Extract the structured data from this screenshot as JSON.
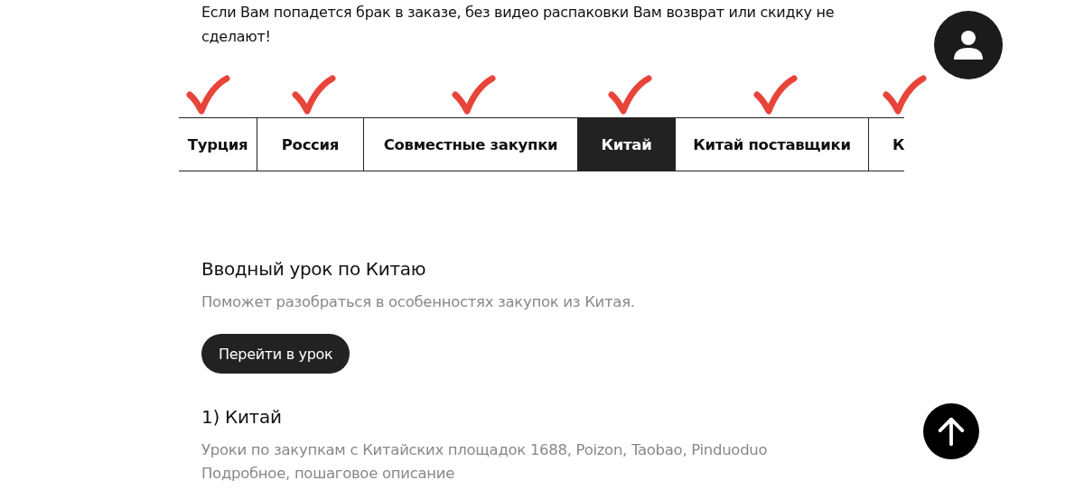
{
  "intro_text": "Если Вам попадется брак в заказе, без видео распаковки Вам возврат или скидку не сделают!",
  "tabs": [
    {
      "label": "Турция",
      "selected": false,
      "marked": true
    },
    {
      "label": "Россия",
      "selected": false,
      "marked": true
    },
    {
      "label": "Совместные закупки",
      "selected": false,
      "marked": true
    },
    {
      "label": "Китай",
      "selected": true,
      "marked": true
    },
    {
      "label": "Китай поставщики",
      "selected": false,
      "marked": true
    },
    {
      "label": "К",
      "selected": false,
      "marked": true
    }
  ],
  "lessons": [
    {
      "title": "Вводный урок по Китаю",
      "description": [
        "Поможет разобраться в особенностях закупок из Китая."
      ],
      "button": "Перейти в урок"
    },
    {
      "title": "1) Китай",
      "description": [
        "Уроки по закупкам с Китайских площадок 1688, Poizon, Taobao, Pinduoduo",
        "Подробное, пошаговое описание"
      ]
    }
  ]
}
